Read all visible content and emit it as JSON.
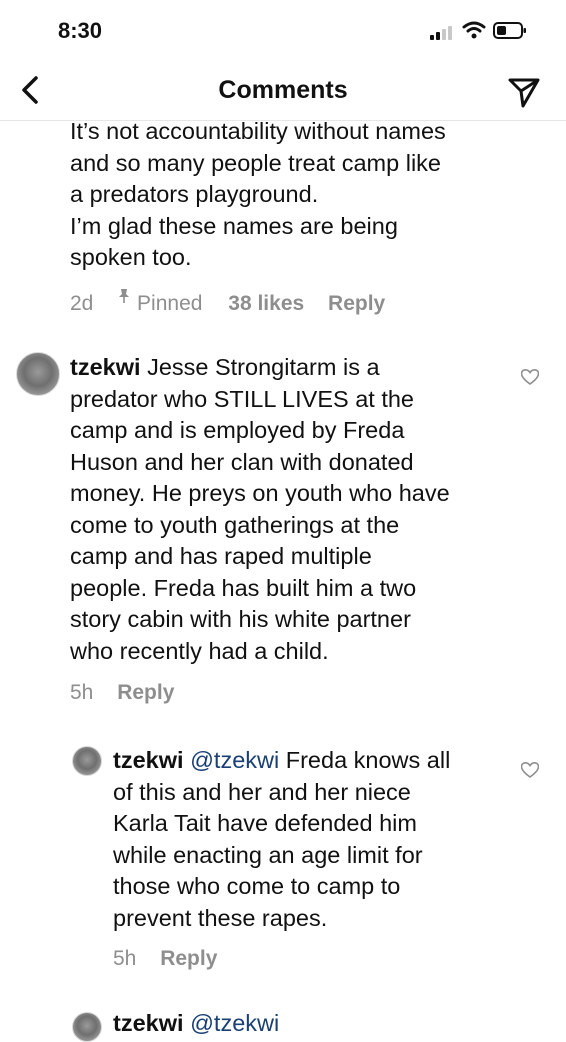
{
  "status_bar": {
    "time": "8:30"
  },
  "header": {
    "title": "Comments"
  },
  "top_comment": {
    "line1": "It’s not accountability without names",
    "line2": "and so many people treat camp like",
    "line3": "a predators playground.",
    "line4": "I’m glad these names are being",
    "line5": "spoken too.",
    "age": "2d",
    "pinned_label": "Pinned",
    "likes": "38 likes",
    "reply_label": "Reply"
  },
  "comment1": {
    "username": "tzekwi",
    "line1": "Jesse Strongitarm is a",
    "line2": "predator who STILL LIVES at the",
    "line3": "camp and is employed by Freda",
    "line4": "Huson and her clan with donated",
    "line5": "money. He preys on youth who have",
    "line6": "come to youth gatherings at the",
    "line7": "camp and has raped multiple",
    "line8": "people. Freda has built him a two",
    "line9": "story cabin with his white partner",
    "line10": "who recently had a child.",
    "age": "5h",
    "reply_label": "Reply"
  },
  "reply1": {
    "username": "tzekwi",
    "mention": "@tzekwi",
    "line1_rest": "Freda knows all",
    "line2": "of this and  her and her niece",
    "line3": "Karla Tait have defended him",
    "line4": "while enacting an age limit for",
    "line5": "those who come to camp to",
    "line6": "prevent these rapes.",
    "age": "5h",
    "reply_label": "Reply"
  },
  "reply2_partial": {
    "username": "tzekwi",
    "mention": "@tzekwi"
  }
}
